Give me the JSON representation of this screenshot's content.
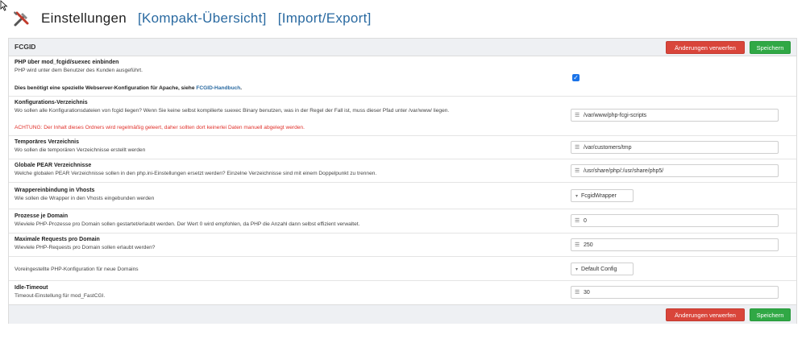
{
  "header": {
    "title": "Einstellungen",
    "link_compact": "Kompakt-Übersicht",
    "link_import": "Import/Export"
  },
  "panel": {
    "title": "FCGID",
    "discard_label": "Änderungen verwerfen",
    "save_label": "Speichern"
  },
  "rows": [
    {
      "label": "PHP über mod_fcgid/suexec einbinden",
      "desc": "PHP wird unter dem Benutzer des Kunden ausgeführt.",
      "note_prefix": "Dies benötigt eine spezielle Webserver-Konfiguration für Apache, siehe ",
      "note_link": "FCGID-Handbuch",
      "note_suffix": ".",
      "checked": true
    },
    {
      "label": "Konfigurations-Verzeichnis",
      "desc": "Wo sollen alle Konfigurationsdateien von fcgid liegen? Wenn Sie keine selbst kompilierte suexec Binary benutzen, was in der Regel der Fall ist, muss dieser Pfad unter /var/www/ liegen.",
      "warning": "ACHTUNG: Der Inhalt dieses Ordners wird regelmäßig geleert, daher sollten dort keinerlei Daten manuell abgelegt werden.",
      "value": "/var/www/php-fcgi-scripts"
    },
    {
      "label": "Temporäres Verzeichnis",
      "desc": "Wo sollen die temporären Verzeichnisse erstellt werden",
      "value": "/var/customers/tmp"
    },
    {
      "label": "Globale PEAR Verzeichnisse",
      "desc": "Welche globalen PEAR Verzeichnisse sollen in den php.ini-Einstellungen ersetzt werden? Einzelne Verzeichnisse sind mit einem Doppelpunkt zu trennen.",
      "value": "/usr/share/php/:/usr/share/php5/"
    },
    {
      "label": "Wrappereinbindung in Vhosts",
      "desc": "Wie sollen die Wrapper in den Vhosts eingebunden werden",
      "value": "FcgidWrapper"
    },
    {
      "label": "Prozesse je Domain",
      "desc": "Wieviele PHP-Prozesse pro Domain sollen gestartet/erlaubt werden. Der Wert 0 wird empfohlen, da PHP die Anzahl dann selbst effizient verwaltet.",
      "value": "0"
    },
    {
      "label": "Maximale Requests pro Domain",
      "desc": "Wieviele PHP-Requests pro Domain sollen erlaubt werden?",
      "value": "250"
    },
    {
      "label": "",
      "desc": "Voreingestellte PHP-Konfiguration für neue Domains",
      "value": "Default Config"
    },
    {
      "label": "Idle-Timeout",
      "desc": "Timeout-Einstellung für mod_FastCGI.",
      "value": "30"
    }
  ],
  "icons": {
    "tools": "tools-icon",
    "text_input": "align-left-icon",
    "select": "chevron-down-icon",
    "check": "check-icon"
  },
  "colors": {
    "link": "#2a6aa1",
    "danger": "#d9453a",
    "success": "#30a845",
    "warning_text": "#e0302a",
    "checkbox": "#1a73e8"
  }
}
